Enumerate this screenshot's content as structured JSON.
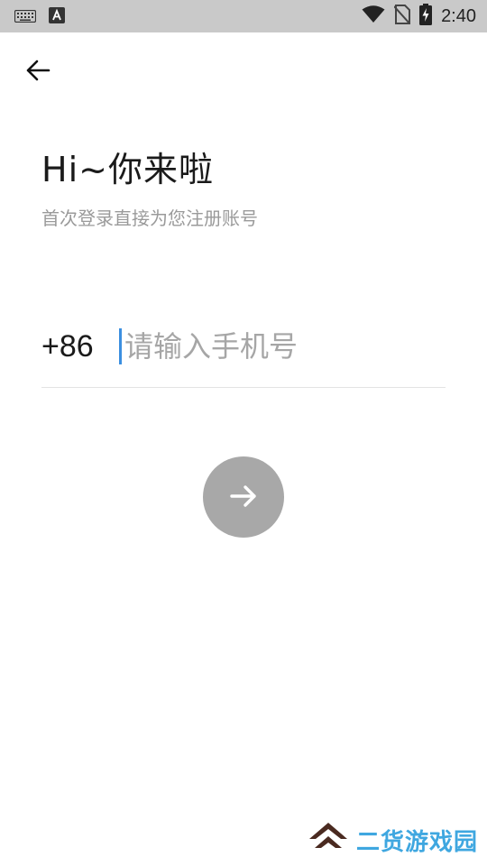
{
  "status_bar": {
    "time": "2:40",
    "icons": [
      "keyboard-icon",
      "a-icon",
      "wifi-icon",
      "no-sim-icon",
      "battery-charging-icon"
    ]
  },
  "header": {
    "back_icon": "arrow-left-icon"
  },
  "greeting": {
    "title": "Hi~你来啦",
    "subtitle": "首次登录直接为您注册账号"
  },
  "phone": {
    "country_code": "+86",
    "value": "",
    "placeholder": "请输入手机号"
  },
  "next_button": {
    "icon": "arrow-right-icon",
    "color": "#a8a8a8"
  },
  "watermark": {
    "text": "二货游戏园",
    "color": "#3fa7e0"
  }
}
